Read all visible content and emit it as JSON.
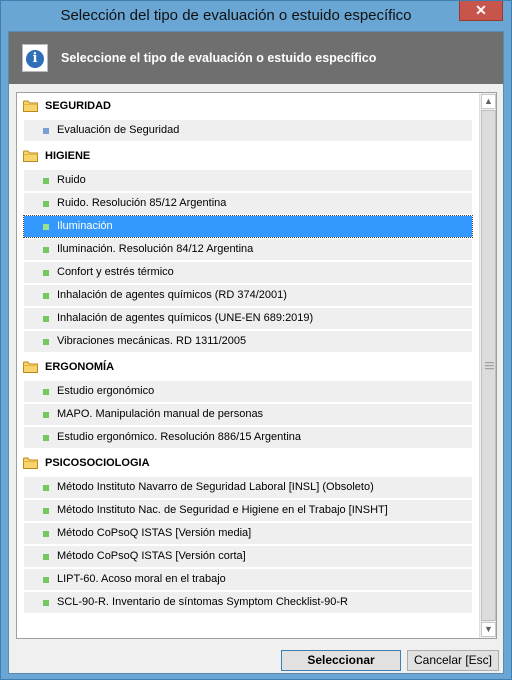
{
  "window": {
    "title": "Selección del tipo de evaluación o estuido específico",
    "close_label": "✕"
  },
  "header": {
    "icon": "info-icon",
    "text": "Seleccione el tipo de evaluación o estuido específico"
  },
  "categories": [
    {
      "label": "SEGURIDAD",
      "items": [
        "Evaluación de Seguridad"
      ]
    },
    {
      "label": "HIGIENE",
      "items": [
        "Ruido",
        "Ruido. Resolución 85/12 Argentina",
        "Iluminación",
        "Iluminación. Resolución 84/12 Argentina",
        "Confort y estrés térmico",
        "Inhalación de agentes químicos (RD 374/2001)",
        "Inhalación de agentes químicos (UNE-EN 689:2019)",
        "Vibraciones mecánicas. RD 1311/2005"
      ]
    },
    {
      "label": "ERGONOMÍA",
      "items": [
        "Estudio ergonómico",
        "MAPO. Manipulación manual de personas",
        "Estudio ergonómico. Resolución 886/15 Argentina"
      ]
    },
    {
      "label": "PSICOSOCIOLOGIA",
      "items": [
        "Método Instituto Navarro de Seguridad Laboral  [INSL]  (Obsoleto)",
        "Método Instituto Nac. de Seguridad e Higiene en el Trabajo  [INSHT]",
        "Método CoPsoQ ISTAS  [Versión media]",
        "Método CoPsoQ ISTAS  [Versión corta]",
        "LIPT-60. Acoso moral en el trabajo",
        "SCL-90-R. Inventario de síntomas Symptom Checklist-90-R"
      ]
    }
  ],
  "selected_item": "Iluminación",
  "buttons": {
    "select_label": "Seleccionar",
    "cancel_label": "Cancelar  [Esc]"
  },
  "colors": {
    "selection": "#3399ff",
    "bullet_green": "#73c860",
    "bullet_blue": "#7a9ed6",
    "header_bg": "#6f6f6f"
  }
}
